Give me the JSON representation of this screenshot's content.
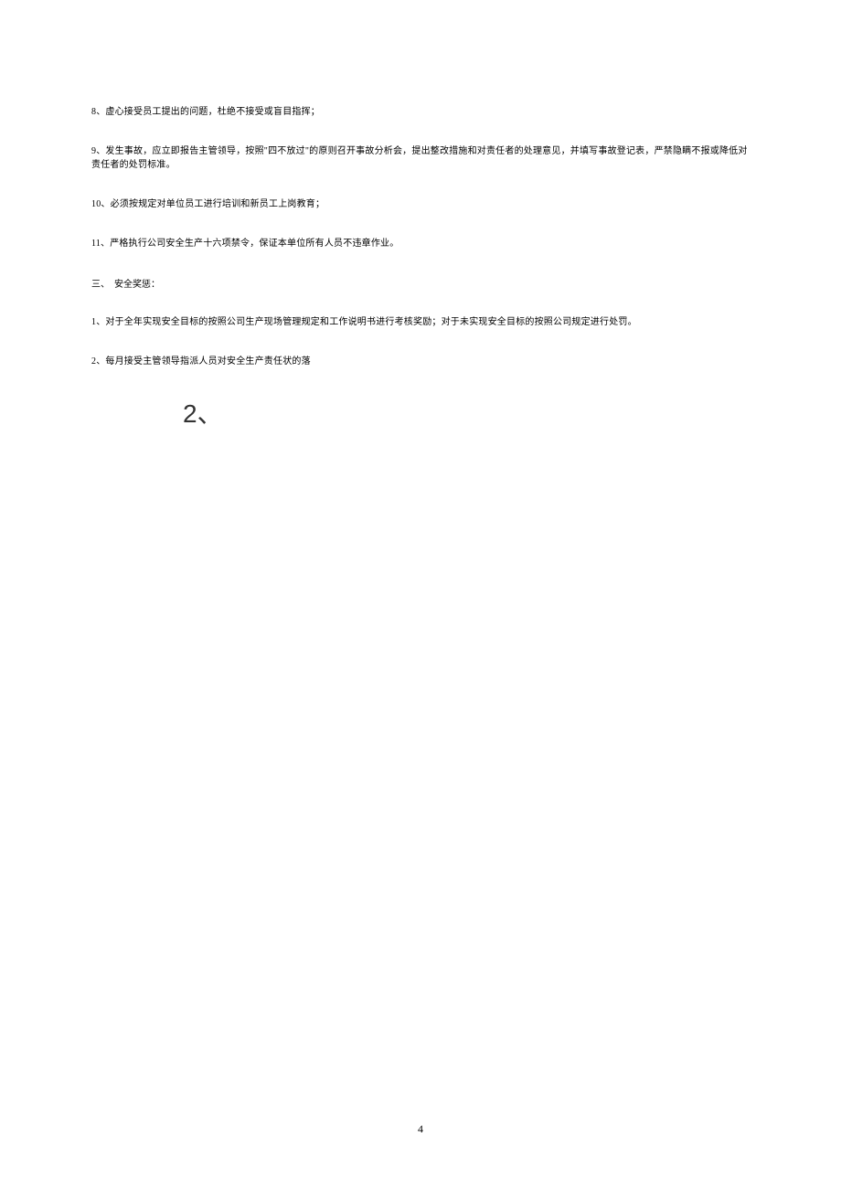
{
  "paragraphs": {
    "p8": "8、虚心接受员工提出的问题，杜绝不接受或盲目指挥；",
    "p9": "9、发生事故，应立即报告主管领导，按照\"四不放过\"的原则召开事故分析会，提出整改措施和对责任者的处理意见，并填写事故登记表，严禁隐瞒不报或降低对责任者的处罚标准。",
    "p10": "10、必须按规定对单位员工进行培训和新员工上岗教育；",
    "p11": "11、严格执行公司安全生产十六项禁令，保证本单位所有人员不违章作业。",
    "section3_title": "三、　安全奖惩：",
    "s3_p1": "1、对于全年实现安全目标的按照公司生产现场管理规定和工作说明书进行考核奖励；对于未实现安全目标的按照公司规定进行处罚。",
    "s3_p2": "2、每月接受主管领导指派人员对安全生产责任状的落"
  },
  "large_label": "2、",
  "page_number": "4"
}
